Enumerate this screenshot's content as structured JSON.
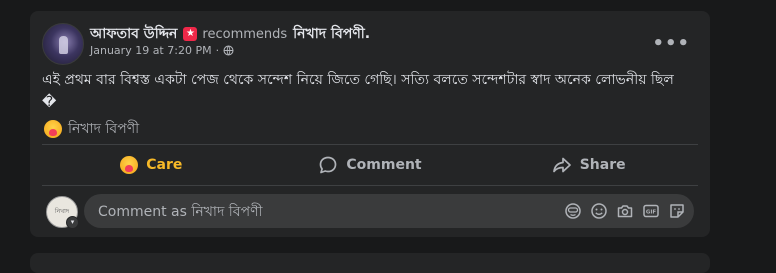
{
  "post": {
    "author": "আফতাব উদ্দিন",
    "badge_icon": "star-badge-icon",
    "recommends_text": "recommends",
    "page_name": "নিখাদ বিপণী.",
    "timestamp": "January 19 at 7:20 PM",
    "separator": "·",
    "privacy_icon": "globe-icon",
    "more_label": "•••",
    "body": "এই প্রথম বার বিশ্বস্ত একটা পেজ থেকে সন্দেশ নিয়ে জিতে গেছি। সত্যি বলতে সন্দেশটার স্বাদ অনেক লোভনীয় ছিল �",
    "reaction_page": "নিখাদ বিপণী"
  },
  "actions": {
    "care_label": "Care",
    "comment_label": "Comment",
    "share_label": "Share"
  },
  "comment": {
    "placeholder": "Comment as নিখাদ বিপণী",
    "avatar_text": "নিখাদ বিপণী"
  },
  "colors": {
    "background": "#18191a",
    "card": "#242526",
    "care": "#f7b928",
    "secondary_text": "#b0b3b8"
  }
}
